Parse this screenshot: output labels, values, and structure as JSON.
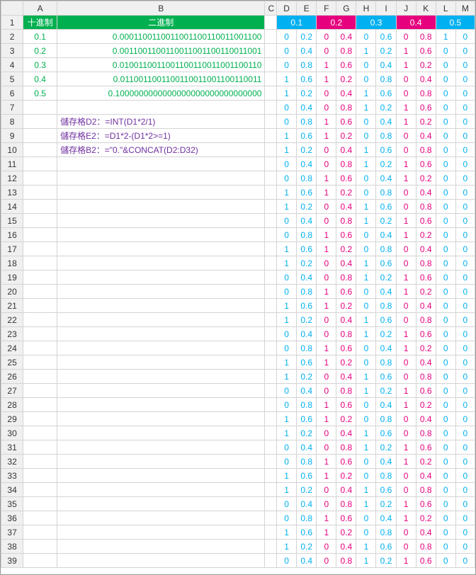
{
  "col_headers": [
    "A",
    "B",
    "C",
    "D",
    "E",
    "F",
    "G",
    "H",
    "I",
    "J",
    "K",
    "L",
    "M"
  ],
  "row_headers": [
    "1",
    "2",
    "3",
    "4",
    "5",
    "6",
    "7",
    "8",
    "9",
    "10",
    "11",
    "12",
    "13",
    "14",
    "15",
    "16",
    "17",
    "18",
    "19",
    "20",
    "21",
    "22",
    "23",
    "24",
    "25",
    "26",
    "27",
    "28",
    "29",
    "30",
    "31",
    "32",
    "33",
    "34",
    "35",
    "36",
    "37",
    "38",
    "39"
  ],
  "header": {
    "A": "十進制",
    "B": "二進制",
    "DE": "0.1",
    "FG": "0.2",
    "HI": "0.3",
    "JK": "0.4",
    "LM": "0.5"
  },
  "colA": [
    "0.1",
    "0.2",
    "0.3",
    "0.4",
    "0.5"
  ],
  "colB": [
    "0.0001100110011001100110011001100",
    "0.0011001100110011001100110011001",
    "0.0100110011001100110011001100110",
    "0.0110011001100110011001100110011",
    "0.1000000000000000000000000000000"
  ],
  "formulas": [
    "儲存格D2：=INT(D1*2/1)",
    "儲存格E2：=D1*2-(D1*2>=1)",
    "儲存格B2：=\"0.\"&CONCAT(D2:D32)"
  ],
  "rows": [
    [
      "0",
      "0.2",
      "0",
      "0.4",
      "0",
      "0.6",
      "0",
      "0.8",
      "1",
      "0"
    ],
    [
      "0",
      "0.4",
      "0",
      "0.8",
      "1",
      "0.2",
      "1",
      "0.6",
      "0",
      "0"
    ],
    [
      "0",
      "0.8",
      "1",
      "0.6",
      "0",
      "0.4",
      "1",
      "0.2",
      "0",
      "0"
    ],
    [
      "1",
      "0.6",
      "1",
      "0.2",
      "0",
      "0.8",
      "0",
      "0.4",
      "0",
      "0"
    ],
    [
      "1",
      "0.2",
      "0",
      "0.4",
      "1",
      "0.6",
      "0",
      "0.8",
      "0",
      "0"
    ],
    [
      "0",
      "0.4",
      "0",
      "0.8",
      "1",
      "0.2",
      "1",
      "0.6",
      "0",
      "0"
    ],
    [
      "0",
      "0.8",
      "1",
      "0.6",
      "0",
      "0.4",
      "1",
      "0.2",
      "0",
      "0"
    ],
    [
      "1",
      "0.6",
      "1",
      "0.2",
      "0",
      "0.8",
      "0",
      "0.4",
      "0",
      "0"
    ],
    [
      "1",
      "0.2",
      "0",
      "0.4",
      "1",
      "0.6",
      "0",
      "0.8",
      "0",
      "0"
    ],
    [
      "0",
      "0.4",
      "0",
      "0.8",
      "1",
      "0.2",
      "1",
      "0.6",
      "0",
      "0"
    ],
    [
      "0",
      "0.8",
      "1",
      "0.6",
      "0",
      "0.4",
      "1",
      "0.2",
      "0",
      "0"
    ],
    [
      "1",
      "0.6",
      "1",
      "0.2",
      "0",
      "0.8",
      "0",
      "0.4",
      "0",
      "0"
    ],
    [
      "1",
      "0.2",
      "0",
      "0.4",
      "1",
      "0.6",
      "0",
      "0.8",
      "0",
      "0"
    ],
    [
      "0",
      "0.4",
      "0",
      "0.8",
      "1",
      "0.2",
      "1",
      "0.6",
      "0",
      "0"
    ],
    [
      "0",
      "0.8",
      "1",
      "0.6",
      "0",
      "0.4",
      "1",
      "0.2",
      "0",
      "0"
    ],
    [
      "1",
      "0.6",
      "1",
      "0.2",
      "0",
      "0.8",
      "0",
      "0.4",
      "0",
      "0"
    ],
    [
      "1",
      "0.2",
      "0",
      "0.4",
      "1",
      "0.6",
      "0",
      "0.8",
      "0",
      "0"
    ],
    [
      "0",
      "0.4",
      "0",
      "0.8",
      "1",
      "0.2",
      "1",
      "0.6",
      "0",
      "0"
    ],
    [
      "0",
      "0.8",
      "1",
      "0.6",
      "0",
      "0.4",
      "1",
      "0.2",
      "0",
      "0"
    ],
    [
      "1",
      "0.6",
      "1",
      "0.2",
      "0",
      "0.8",
      "0",
      "0.4",
      "0",
      "0"
    ],
    [
      "1",
      "0.2",
      "0",
      "0.4",
      "1",
      "0.6",
      "0",
      "0.8",
      "0",
      "0"
    ],
    [
      "0",
      "0.4",
      "0",
      "0.8",
      "1",
      "0.2",
      "1",
      "0.6",
      "0",
      "0"
    ],
    [
      "0",
      "0.8",
      "1",
      "0.6",
      "0",
      "0.4",
      "1",
      "0.2",
      "0",
      "0"
    ],
    [
      "1",
      "0.6",
      "1",
      "0.2",
      "0",
      "0.8",
      "0",
      "0.4",
      "0",
      "0"
    ],
    [
      "1",
      "0.2",
      "0",
      "0.4",
      "1",
      "0.6",
      "0",
      "0.8",
      "0",
      "0"
    ],
    [
      "0",
      "0.4",
      "0",
      "0.8",
      "1",
      "0.2",
      "1",
      "0.6",
      "0",
      "0"
    ],
    [
      "0",
      "0.8",
      "1",
      "0.6",
      "0",
      "0.4",
      "1",
      "0.2",
      "0",
      "0"
    ],
    [
      "1",
      "0.6",
      "1",
      "0.2",
      "0",
      "0.8",
      "0",
      "0.4",
      "0",
      "0"
    ],
    [
      "1",
      "0.2",
      "0",
      "0.4",
      "1",
      "0.6",
      "0",
      "0.8",
      "0",
      "0"
    ],
    [
      "0",
      "0.4",
      "0",
      "0.8",
      "1",
      "0.2",
      "1",
      "0.6",
      "0",
      "0"
    ],
    [
      "0",
      "0.8",
      "1",
      "0.6",
      "0",
      "0.4",
      "1",
      "0.2",
      "0",
      "0"
    ],
    [
      "1",
      "0.6",
      "1",
      "0.2",
      "0",
      "0.8",
      "0",
      "0.4",
      "0",
      "0"
    ],
    [
      "1",
      "0.2",
      "0",
      "0.4",
      "1",
      "0.6",
      "0",
      "0.8",
      "0",
      "0"
    ],
    [
      "0",
      "0.4",
      "0",
      "0.8",
      "1",
      "0.2",
      "1",
      "0.6",
      "0",
      "0"
    ],
    [
      "0",
      "0.8",
      "1",
      "0.6",
      "0",
      "0.4",
      "1",
      "0.2",
      "0",
      "0"
    ],
    [
      "1",
      "0.6",
      "1",
      "0.2",
      "0",
      "0.8",
      "0",
      "0.4",
      "0",
      "0"
    ],
    [
      "1",
      "0.2",
      "0",
      "0.4",
      "1",
      "0.6",
      "0",
      "0.8",
      "0",
      "0"
    ],
    [
      "0",
      "0.4",
      "0",
      "0.8",
      "1",
      "0.2",
      "1",
      "0.6",
      "0",
      "0"
    ]
  ]
}
